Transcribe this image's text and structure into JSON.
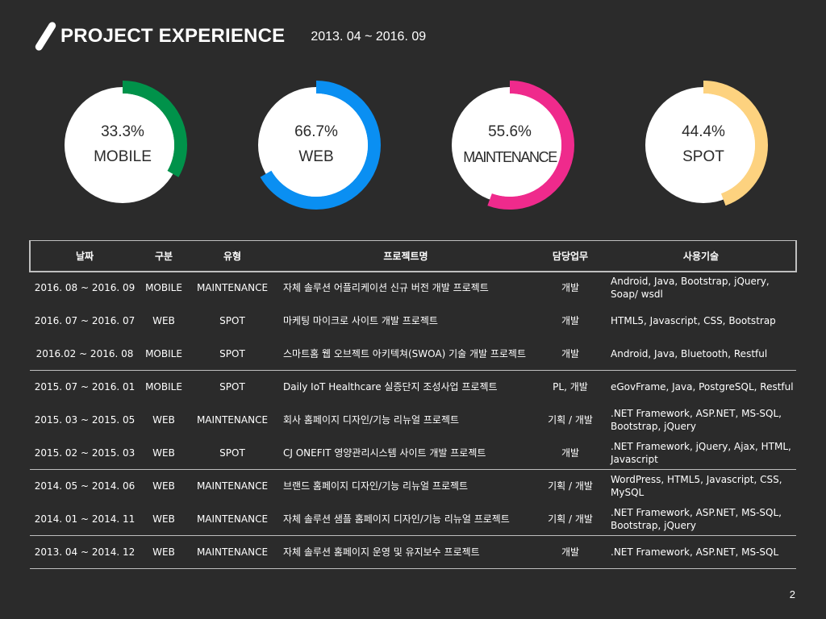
{
  "header": {
    "title": "PROJECT EXPERIENCE",
    "period": "2013. 04 ~ 2016. 09"
  },
  "donuts": [
    {
      "percent": "33.3%",
      "label": "MOBILE",
      "value": 0.333,
      "color": "#00924a"
    },
    {
      "percent": "66.7%",
      "label": "WEB",
      "value": 0.667,
      "color": "#0a8ff2"
    },
    {
      "percent": "55.6%",
      "label": "MAINTENANCE",
      "value": 0.556,
      "color": "#ef2a8c"
    },
    {
      "percent": "44.4%",
      "label": "SPOT",
      "value": 0.444,
      "color": "#fdd27f"
    }
  ],
  "table": {
    "headers": [
      "날짜",
      "구분",
      "유형",
      "프로젝트명",
      "담당업무",
      "사용기술"
    ],
    "rows": [
      [
        "2016. 08 ~ 2016. 09",
        "MOBILE",
        "MAINTENANCE",
        "자체 솔루션 어플리케이션 신규 버전 개발 프로젝트",
        "개발",
        "Android, Java, Bootstrap, jQuery, Soap/ wsdl"
      ],
      [
        "2016. 07 ~ 2016. 07",
        "WEB",
        "SPOT",
        "마케팅 마이크로 사이트 개발 프로젝트",
        "개발",
        "HTML5, Javascript, CSS, Bootstrap"
      ],
      [
        "2016.02 ~ 2016. 08",
        "MOBILE",
        "SPOT",
        "스마트홈 웹 오브젝트 아키텍쳐(SWOA) 기술 개발 프로젝트",
        "개발",
        "Android, Java, Bluetooth, Restful"
      ],
      [
        "2015. 07 ~ 2016. 01",
        "MOBILE",
        "SPOT",
        "Daily IoT Healthcare 실증단지 조성사업 프로젝트",
        "PL, 개발",
        "eGovFrame, Java, PostgreSQL, Restful"
      ],
      [
        "2015. 03 ~ 2015. 05",
        "WEB",
        "MAINTENANCE",
        "회사 홈페이지 디자인/기능 리뉴얼 프로젝트",
        "기획 / 개발",
        ".NET Framework, ASP.NET, MS-SQL, Bootstrap, jQuery"
      ],
      [
        "2015. 02 ~ 2015. 03",
        "WEB",
        "SPOT",
        "CJ ONEFIT 영양관리시스템 사이트 개발 프로젝트",
        "개발",
        ".NET Framework,  jQuery,  Ajax, HTML, Javascript"
      ],
      [
        "2014. 05 ~ 2014. 06",
        "WEB",
        "MAINTENANCE",
        "브랜드 홈페이지 디자인/기능 리뉴얼 프로젝트",
        "기획 / 개발",
        "WordPress, HTML5, Javascript, CSS, MySQL"
      ],
      [
        "2014. 01 ~ 2014. 11",
        "WEB",
        "MAINTENANCE",
        "자체 솔루션 샘플 홈페이지 디자인/기능 리뉴얼 프로젝트",
        "기획 / 개발",
        ".NET Framework, ASP.NET, MS-SQL, Bootstrap, jQuery"
      ],
      [
        "2013. 04 ~ 2014. 12",
        "WEB",
        "MAINTENANCE",
        "자체 솔루션 홈페이지 운영 및 유지보수 프로젝트",
        "개발",
        ".NET Framework, ASP.NET, MS-SQL"
      ]
    ]
  },
  "page_number": "2"
}
